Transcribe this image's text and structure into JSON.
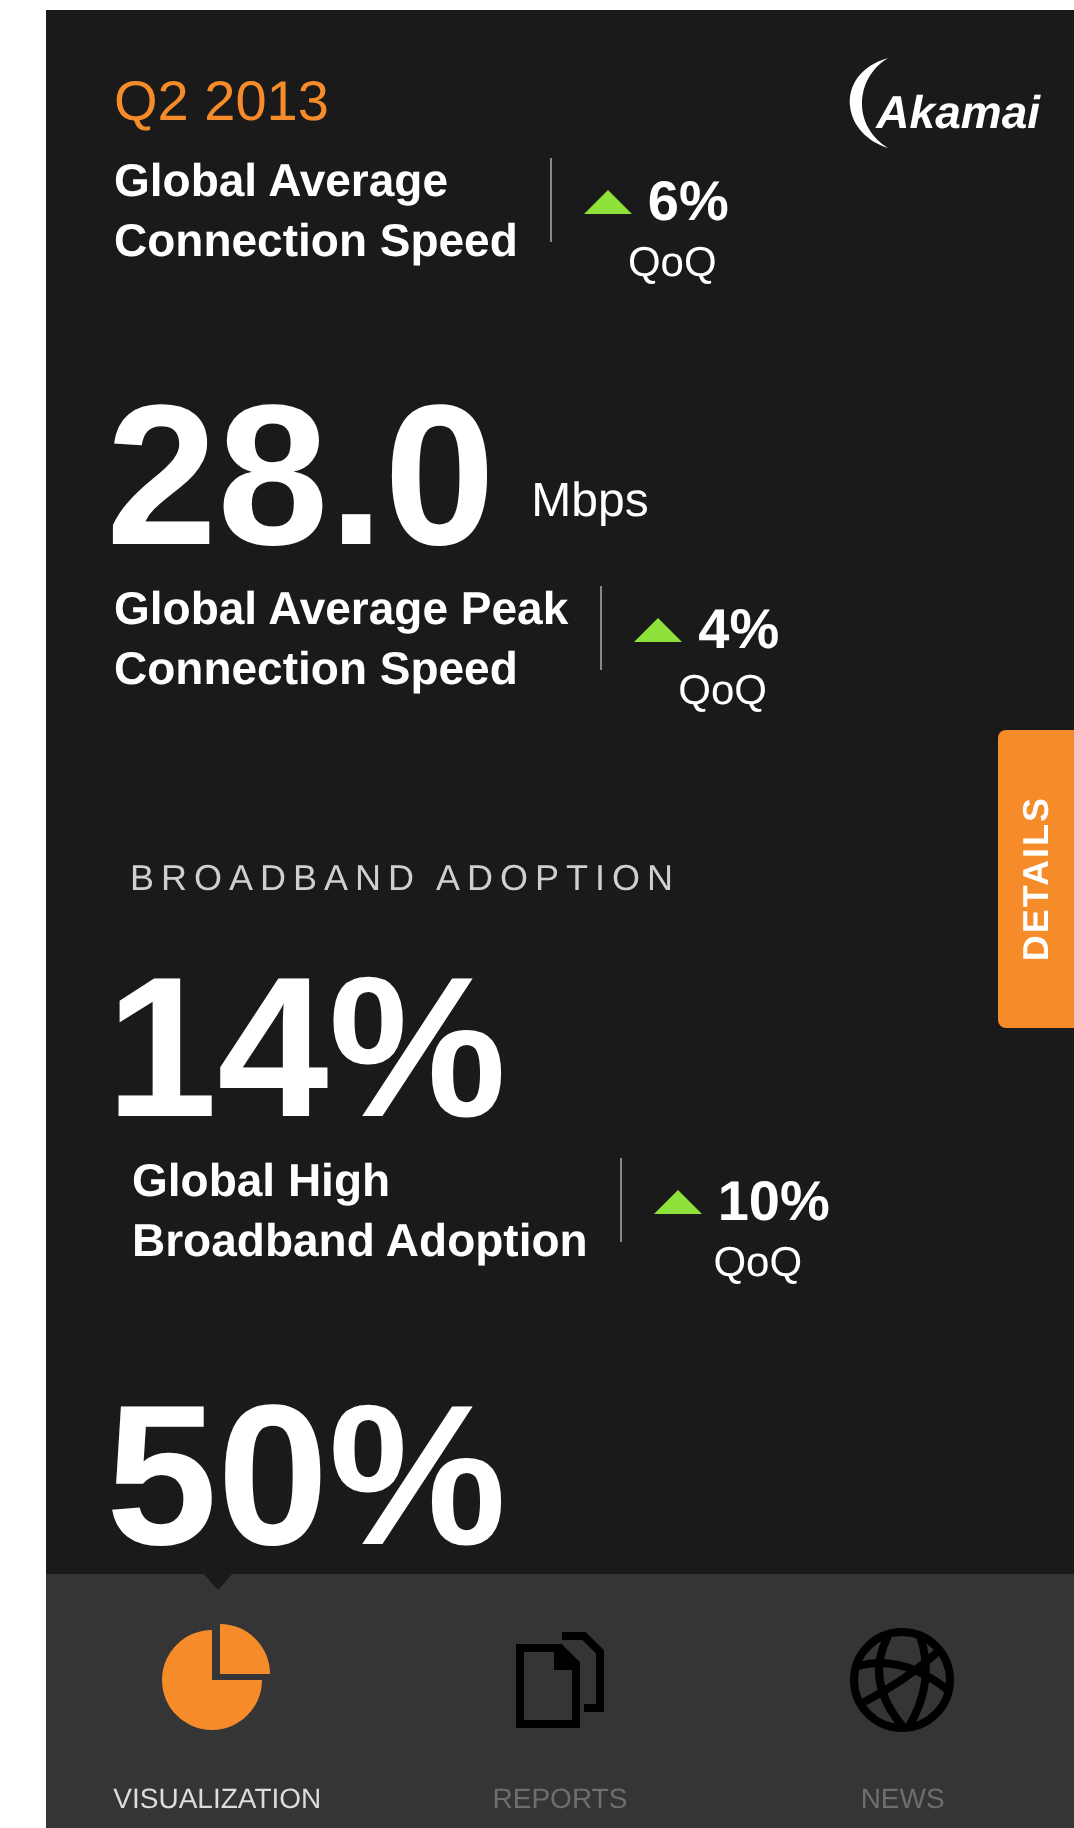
{
  "header": {
    "period": "Q2 2013",
    "logo": "Akamai"
  },
  "items": [
    {
      "kind": "label",
      "lines": [
        "Global Average",
        "Connection Speed"
      ],
      "rising": true,
      "change": "6%",
      "period": "QoQ"
    },
    {
      "kind": "value",
      "value": "28.0",
      "unit": "Mbps"
    },
    {
      "kind": "label",
      "lines": [
        "Global Average Peak",
        "Connection Speed"
      ],
      "rising": true,
      "change": "4%",
      "period": "QoQ"
    },
    {
      "kind": "heading",
      "text": "BROADBAND ADOPTION"
    },
    {
      "kind": "value",
      "value": "14%"
    },
    {
      "kind": "label",
      "lines": [
        "Global High",
        "Broadband Adoption"
      ],
      "rising": true,
      "change": "10%",
      "period": "QoQ"
    },
    {
      "kind": "value",
      "value": "50%"
    }
  ],
  "side_tab": "DETAILS",
  "tabs": [
    {
      "label": "VISUALIZATION",
      "kind": "pie",
      "selected": true
    },
    {
      "label": "REPORTS",
      "kind": "documents",
      "selected": false
    },
    {
      "label": "NEWS",
      "kind": "globe",
      "selected": false
    }
  ]
}
